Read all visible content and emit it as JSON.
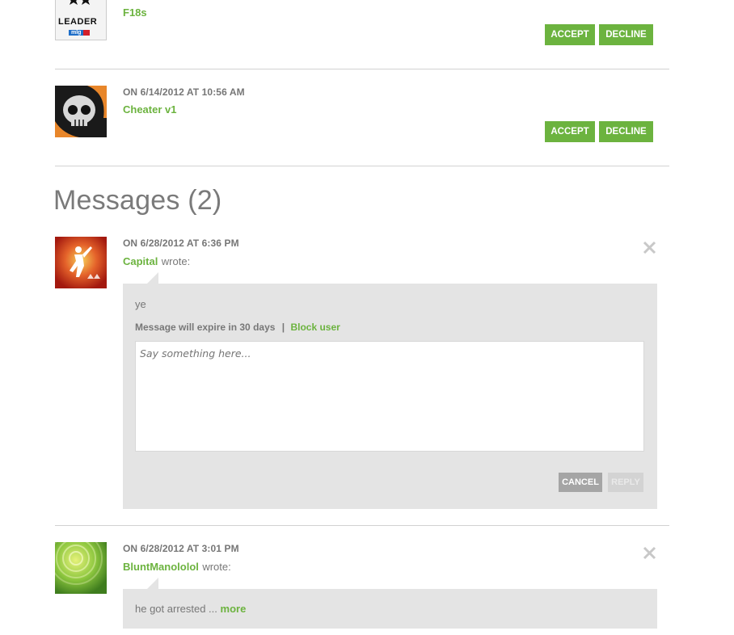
{
  "requests": [
    {
      "name": "F18s",
      "timestamp": "",
      "accept": "ACCEPT",
      "decline": "DECLINE",
      "avatar_text": "LEADER",
      "avatar_badge": "mlg"
    },
    {
      "name": "Cheater v1",
      "timestamp": "ON 6/14/2012 AT 10:56 AM",
      "accept": "ACCEPT",
      "decline": "DECLINE"
    }
  ],
  "messages_title": "Messages (2)",
  "messages": [
    {
      "timestamp": "ON 6/28/2012 AT 6:36 PM",
      "sender": "Capital",
      "wrote": "wrote:",
      "body": "ye",
      "expire": "Message will expire in 30 days",
      "separator": "|",
      "block": "Block user",
      "reply_placeholder": "Say something here...",
      "cancel": "CANCEL",
      "reply": "REPLY"
    },
    {
      "timestamp": "ON 6/28/2012 AT 3:01 PM",
      "sender": "BluntManololol",
      "wrote": "wrote:",
      "body": "he got arrested ...",
      "more": "more"
    }
  ],
  "colors": {
    "accent": "#6cb33f",
    "bubble": "#e4e4e4",
    "divider": "#d2d2d2"
  }
}
